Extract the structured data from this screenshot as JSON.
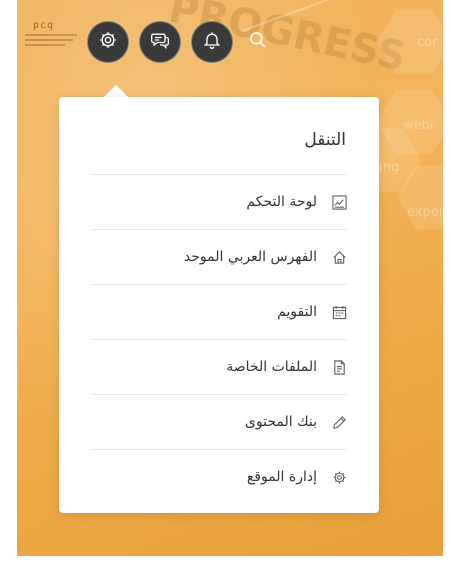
{
  "brand": {
    "logo_text": "pcq"
  },
  "background": {
    "decorative_words": [
      "PROGRESS",
      "cor",
      "webi",
      "experi",
      "ang"
    ]
  },
  "topbar": {
    "icons": [
      "gear-icon",
      "chat-icon",
      "bell-icon",
      "search-icon"
    ]
  },
  "navigation": {
    "title": "التنقل",
    "items": [
      {
        "label": "لوحة التحكم",
        "icon": "dashboard-icon"
      },
      {
        "label": "الفهرس العربي الموحد",
        "icon": "home-icon"
      },
      {
        "label": "التقويم",
        "icon": "calendar-icon"
      },
      {
        "label": "الملفات الخاصة",
        "icon": "file-icon"
      },
      {
        "label": "بنك المحتوى",
        "icon": "pencil-icon"
      },
      {
        "label": "إدارة الموقع",
        "icon": "gear-icon"
      }
    ]
  },
  "colors": {
    "background_accent": "#f0b25a",
    "icon_button": "#3a3a3a",
    "panel": "#ffffff",
    "text": "#333333",
    "divider": "#e6e6e6"
  }
}
